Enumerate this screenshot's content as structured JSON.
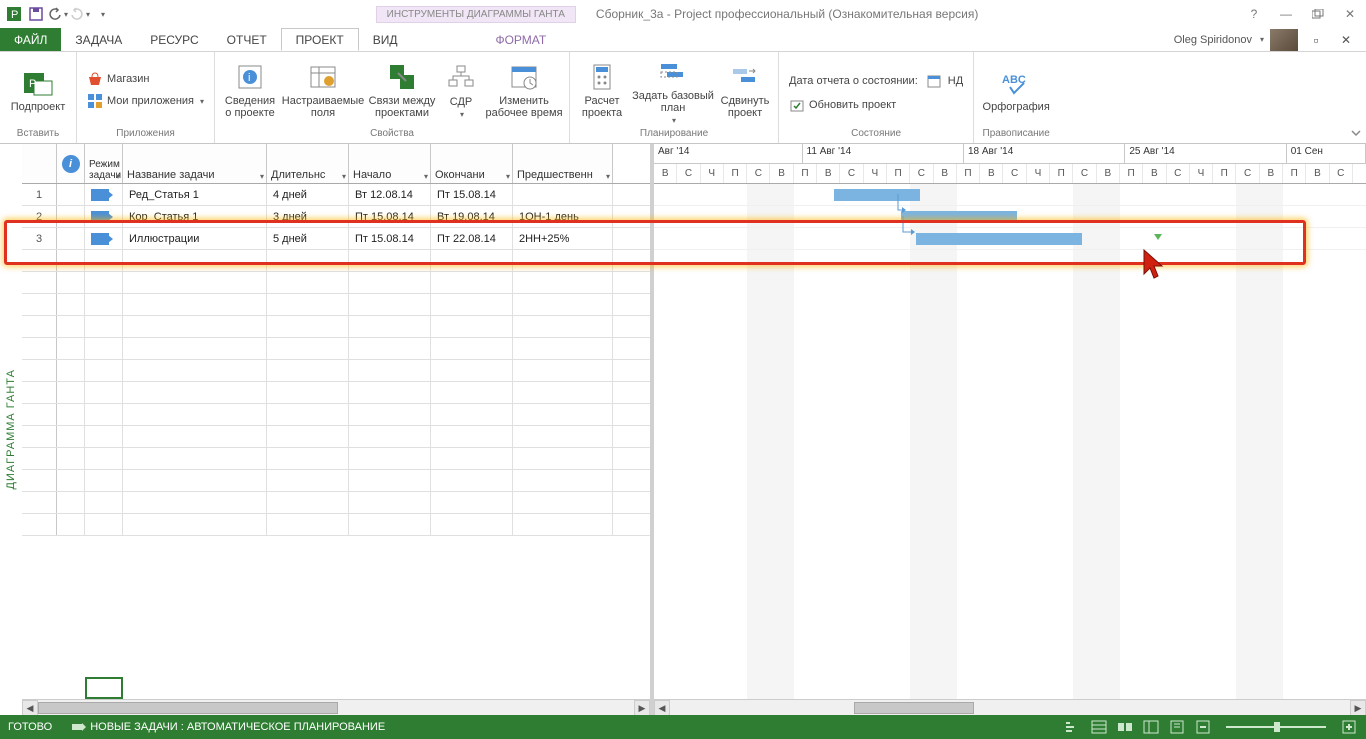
{
  "title": {
    "tool_tab": "ИНСТРУМЕНТЫ ДИАГРАММЫ ГАНТА",
    "document": "Сборник_3а - Project профессиональный (Ознакомительная версия)"
  },
  "menus": {
    "file": "ФАЙЛ",
    "task": "ЗАДАЧА",
    "resource": "РЕСУРС",
    "report": "ОТЧЕТ",
    "project": "ПРОЕКТ",
    "view": "ВИД",
    "format": "ФОРМАТ"
  },
  "user": {
    "name": "Oleg Spiridonov"
  },
  "ribbon": {
    "insert": {
      "subproject": "Подпроект",
      "group": "Вставить"
    },
    "apps": {
      "store": "Магазин",
      "myapps": "Мои приложения",
      "group": "Приложения"
    },
    "props": {
      "info": "Сведения о проекте",
      "fields": "Настраиваемые поля",
      "links": "Связи между проектами",
      "wbs": "СДР",
      "worktime": "Изменить рабочее время",
      "group": "Свойства"
    },
    "plan": {
      "calc": "Расчет проекта",
      "baseline": "Задать базовый план",
      "move": "Сдвинуть проект",
      "group": "Планирование"
    },
    "status": {
      "date_label": "Дата отчета о состоянии:",
      "date_value": "НД",
      "update": "Обновить проект",
      "group": "Состояние"
    },
    "spell": {
      "btn": "Орфография",
      "group": "Правописание"
    }
  },
  "grid": {
    "headers": {
      "mode": "Режим задачи",
      "name": "Название задачи",
      "duration": "Длительнс",
      "start": "Начало",
      "finish": "Окончани",
      "pred": "Предшественн"
    },
    "rows": [
      {
        "num": "1",
        "name": "Ред_Статья 1",
        "dur": "4 дней",
        "start": "Вт 12.08.14",
        "finish": "Пт 15.08.14",
        "pred": ""
      },
      {
        "num": "2",
        "name": "Кор_Статья 1",
        "dur": "3 дней",
        "start": "Пт 15.08.14",
        "finish": "Вт 19.08.14",
        "pred": "1ОН-1 день"
      },
      {
        "num": "3",
        "name": "Иллюстрации",
        "dur": "5 дней",
        "start": "Пт 15.08.14",
        "finish": "Пт 22.08.14",
        "pred": "2НН+25%"
      }
    ]
  },
  "timeline": {
    "periods": [
      "Авг '14",
      "11 Авг '14",
      "18 Авг '14",
      "25 Авг '14",
      "01 Сен"
    ],
    "days_cycle": [
      "В",
      "С",
      "Ч",
      "П",
      "С",
      "В",
      "П"
    ]
  },
  "side_label": "ДИАГРАММА ГАНТА",
  "statusbar": {
    "ready": "ГОТОВО",
    "newtasks": "НОВЫЕ ЗАДАЧИ : АВТОМАТИЧЕСКОЕ ПЛАНИРОВАНИЕ"
  }
}
